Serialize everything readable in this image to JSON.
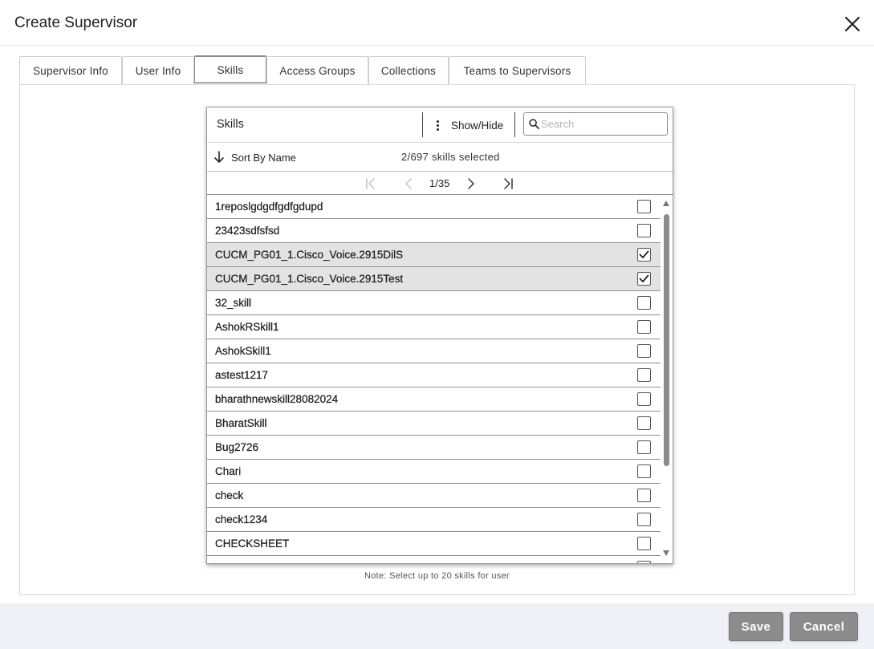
{
  "dialog": {
    "title": "Create Supervisor"
  },
  "tabs": [
    {
      "label": "Supervisor Info",
      "active": false
    },
    {
      "label": "User Info",
      "active": false
    },
    {
      "label": "Skills",
      "active": true
    },
    {
      "label": "Access Groups",
      "active": false
    },
    {
      "label": "Collections",
      "active": false
    },
    {
      "label": "Teams to Supervisors",
      "active": false
    }
  ],
  "skills": {
    "title": "Skills",
    "show_hide_label": "Show/Hide",
    "search_placeholder": "Search",
    "sort_label": "Sort By Name",
    "selected_count": "2/697 skills selected",
    "page": "1/35",
    "items": [
      {
        "name": "1reposlgdgdfgdfgdupd",
        "checked": false
      },
      {
        "name": "23423sdfsfsd",
        "checked": false
      },
      {
        "name": "CUCM_PG01_1.Cisco_Voice.2915DilS",
        "checked": true
      },
      {
        "name": "CUCM_PG01_1.Cisco_Voice.2915Test",
        "checked": true
      },
      {
        "name": "32_skill",
        "checked": false
      },
      {
        "name": "AshokRSkill1",
        "checked": false
      },
      {
        "name": "AshokSkill1",
        "checked": false
      },
      {
        "name": "astest1217",
        "checked": false
      },
      {
        "name": "bharathnewskill28082024",
        "checked": false
      },
      {
        "name": "BharatSkill",
        "checked": false
      },
      {
        "name": "Bug2726",
        "checked": false
      },
      {
        "name": "Chari",
        "checked": false
      },
      {
        "name": "check",
        "checked": false
      },
      {
        "name": "check1234",
        "checked": false
      },
      {
        "name": "CHECKSHEET",
        "checked": false
      }
    ],
    "note": "Note: Select up to 20 skills for user"
  },
  "footer": {
    "save_label": "Save",
    "cancel_label": "Cancel"
  },
  "colors": {
    "selected_row": "#e3e3e3",
    "button_bg": "#8c8c8c",
    "footer_bg": "#f0f1f6"
  }
}
